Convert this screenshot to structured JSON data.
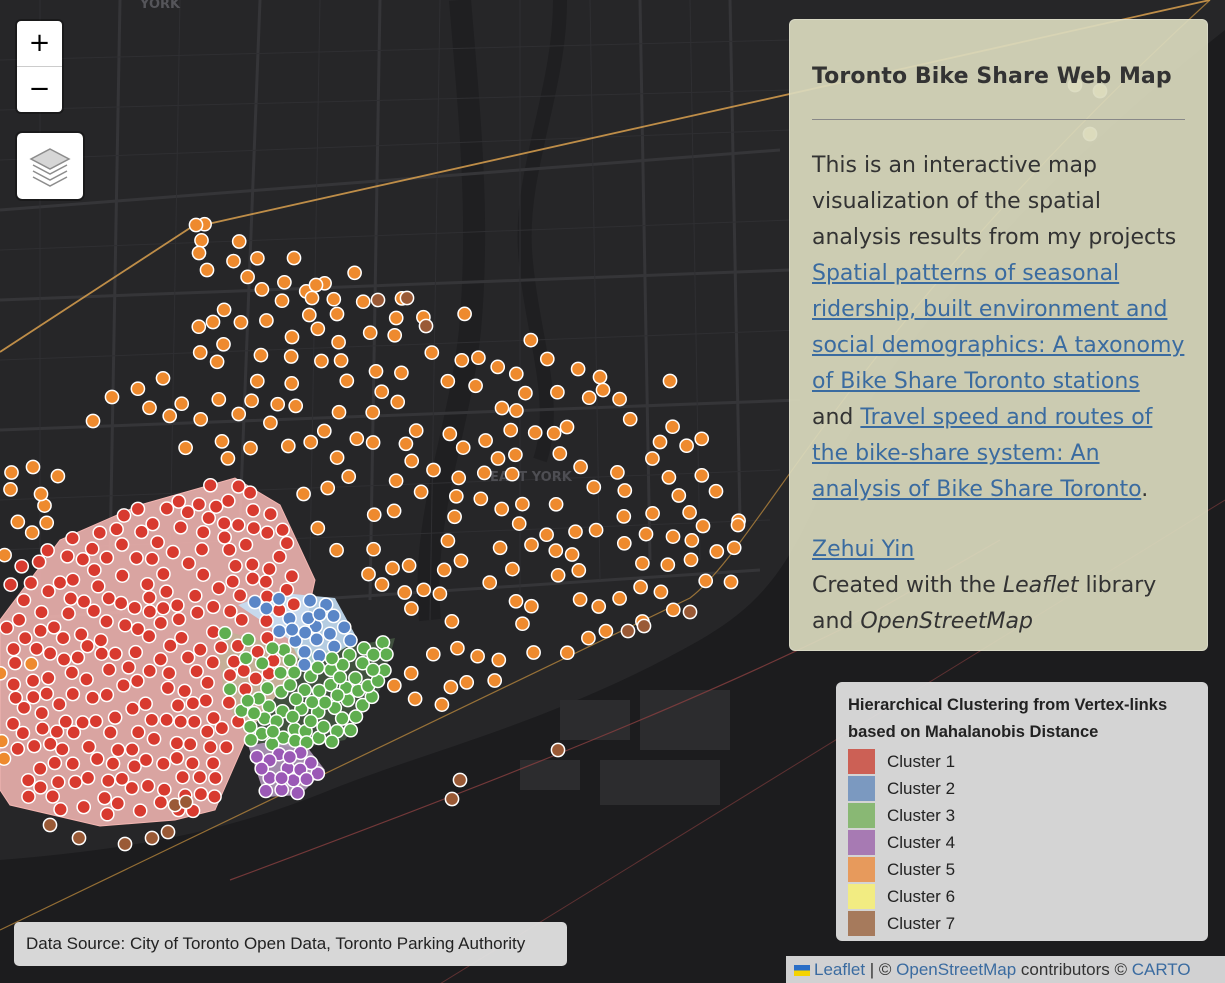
{
  "map": {
    "place_labels": [
      "YORK",
      "EAST YORK"
    ]
  },
  "controls": {
    "zoom_in": "+",
    "zoom_out": "−",
    "layers_icon": "layers-icon"
  },
  "info_panel": {
    "title": "Toronto Bike Share Web Map",
    "intro": "This is an interactive map visualization of the spatial analysis results from my projects ",
    "link1": "Spatial patterns of seasonal ridership, built environment and social demographics: A taxonomy of Bike Share Toronto stations",
    "and_text": " and ",
    "link2": "Travel speed and routes of the bike-share system: An analysis of Bike Share Toronto",
    "period": ".",
    "author": "Zehui Yin",
    "created_prefix": "Created with the ",
    "leaflet": "Leaflet",
    "library_and": " library and ",
    "osm": "OpenStreetMap"
  },
  "legend": {
    "title": "Hierarchical Clustering from Vertex-links based on Mahalanobis Distance",
    "items": [
      {
        "label": "Cluster 1",
        "color": "#cc6055"
      },
      {
        "label": "Cluster 2",
        "color": "#7b99c0"
      },
      {
        "label": "Cluster 3",
        "color": "#89b874"
      },
      {
        "label": "Cluster 4",
        "color": "#a77ab3"
      },
      {
        "label": "Cluster 5",
        "color": "#e79a5c"
      },
      {
        "label": "Cluster 6",
        "color": "#f2ec82"
      },
      {
        "label": "Cluster 7",
        "color": "#a67a5c"
      }
    ]
  },
  "marker_colors": {
    "cluster1": "#d83a2f",
    "cluster2": "#5a86c7",
    "cluster3": "#5fae4f",
    "cluster4": "#9b59b6",
    "cluster5": "#ee8a2e",
    "cluster6": "#f3e7a8",
    "cluster7": "#9a5a36"
  },
  "source": "Data Source: City of Toronto Open Data, Toronto Parking Authority",
  "attribution": {
    "leaflet": "Leaflet",
    "sep": " | © ",
    "osm": "OpenStreetMap",
    "contributors": " contributors © ",
    "carto": "CARTO"
  }
}
